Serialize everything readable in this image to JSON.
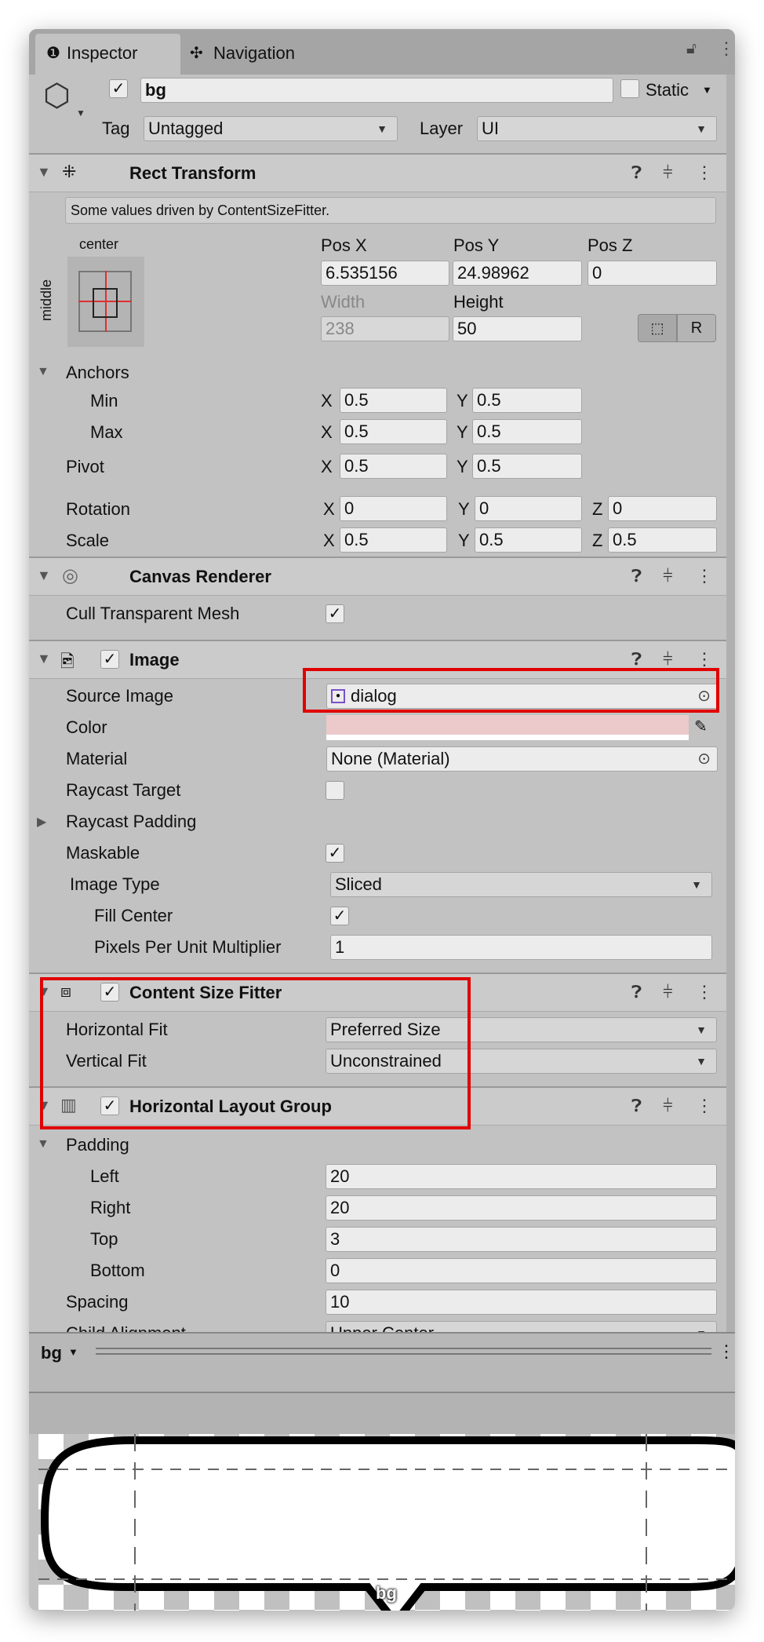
{
  "tabs": {
    "inspector": "Inspector",
    "navigation": "Navigation"
  },
  "object": {
    "name": "bg",
    "active": true,
    "static_label": "Static",
    "static": false,
    "tag_label": "Tag",
    "tag": "Untagged",
    "layer_label": "Layer",
    "layer": "UI"
  },
  "rect_transform": {
    "title": "Rect Transform",
    "info": "Some values driven by ContentSizeFitter.",
    "anchor_h": "center",
    "anchor_v": "middle",
    "pos_x_label": "Pos X",
    "pos_y_label": "Pos Y",
    "pos_z_label": "Pos Z",
    "pos_x": "6.535156",
    "pos_y": "24.98962",
    "pos_z": "0",
    "width_label": "Width",
    "height_label": "Height",
    "width": "238",
    "height": "50",
    "raw_btn": "R",
    "anchors_label": "Anchors",
    "min_label": "Min",
    "max_label": "Max",
    "pivot_label": "Pivot",
    "rotation_label": "Rotation",
    "scale_label": "Scale",
    "x": "X",
    "y": "Y",
    "z": "Z",
    "min_x": "0.5",
    "min_y": "0.5",
    "max_x": "0.5",
    "max_y": "0.5",
    "pivot_x": "0.5",
    "pivot_y": "0.5",
    "rot_x": "0",
    "rot_y": "0",
    "rot_z": "0",
    "scale_x": "0.5",
    "scale_y": "0.5",
    "scale_z": "0.5"
  },
  "canvas_renderer": {
    "title": "Canvas Renderer",
    "cull_label": "Cull Transparent Mesh",
    "cull": true
  },
  "image": {
    "title": "Image",
    "enabled": true,
    "source_label": "Source Image",
    "source": "dialog",
    "color_label": "Color",
    "color": "#ecc9cb",
    "material_label": "Material",
    "material": "None (Material)",
    "raycast_label": "Raycast Target",
    "raycast": false,
    "raycast_padding_label": "Raycast Padding",
    "maskable_label": "Maskable",
    "maskable": true,
    "type_label": "Image Type",
    "type": "Sliced",
    "fill_center_label": "Fill Center",
    "fill_center": true,
    "ppu_label": "Pixels Per Unit Multiplier",
    "ppu": "1"
  },
  "content_size_fitter": {
    "title": "Content Size Fitter",
    "enabled": true,
    "hfit_label": "Horizontal Fit",
    "hfit": "Preferred Size",
    "vfit_label": "Vertical Fit",
    "vfit": "Unconstrained"
  },
  "hlg": {
    "title": "Horizontal Layout Group",
    "enabled": true,
    "padding_label": "Padding",
    "left_label": "Left",
    "left": "20",
    "right_label": "Right",
    "right": "20",
    "top_label": "Top",
    "top": "3",
    "bottom_label": "Bottom",
    "bottom": "0",
    "spacing_label": "Spacing",
    "spacing": "10",
    "child_alignment_label": "Child Alignment",
    "child_alignment": "Upper Center"
  },
  "preview": {
    "object": "bg",
    "label": "bg"
  },
  "highlight_color": "#e00000"
}
